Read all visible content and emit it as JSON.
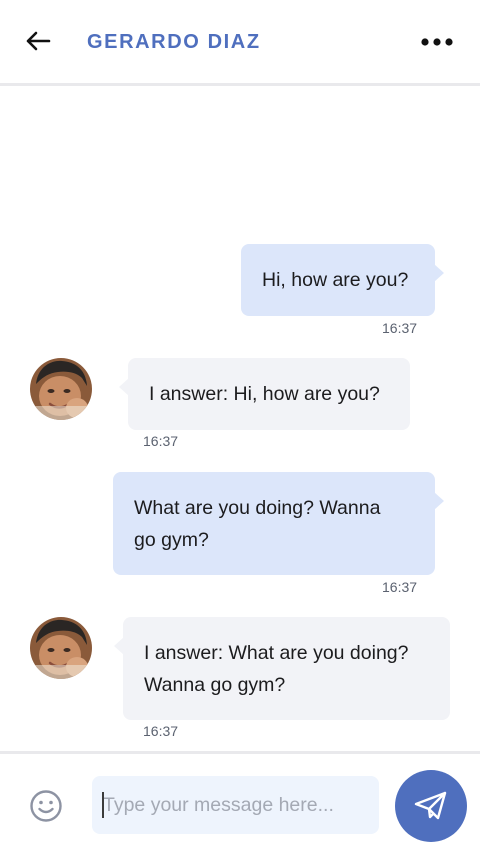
{
  "header": {
    "title": "GERARDO DIAZ",
    "back_icon": "arrow-left-icon",
    "menu_icon": "more-horizontal-icon"
  },
  "messages": [
    {
      "direction": "outgoing",
      "text_lines": [
        "Hi, how are you?"
      ],
      "time": "16:37"
    },
    {
      "direction": "incoming",
      "text_lines": [
        "I answer: Hi, how are you?"
      ],
      "time": "16:37"
    },
    {
      "direction": "outgoing",
      "text_lines": [
        "What are you doing? Wanna",
        "go gym?"
      ],
      "time": "16:37"
    },
    {
      "direction": "incoming",
      "text_lines": [
        "I answer: What are you doing?",
        "Wanna go gym?"
      ],
      "time": "16:37"
    }
  ],
  "composer": {
    "placeholder": "Type your message here...",
    "value": "",
    "emoji_icon": "smiley-icon",
    "send_icon": "paper-plane-icon"
  },
  "colors": {
    "accent": "#4f6fbe",
    "outgoing_bubble": "#dce6fa",
    "incoming_bubble": "#f2f3f7",
    "input_background": "#eef4fd"
  }
}
